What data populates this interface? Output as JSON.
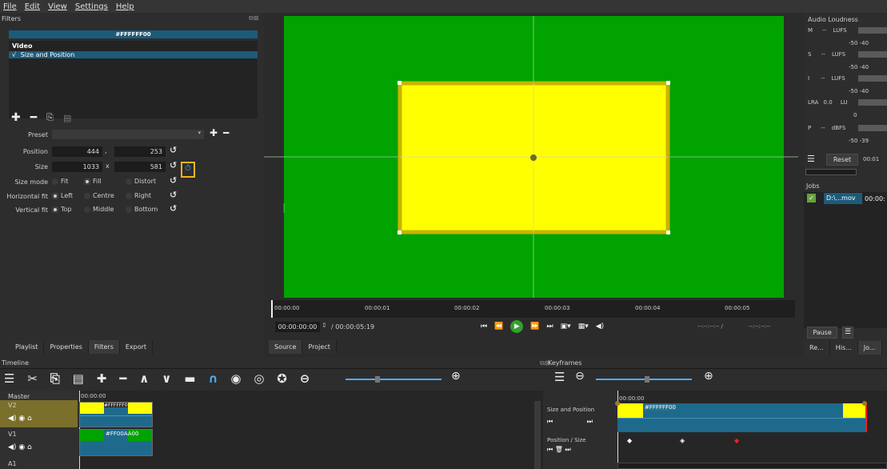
{
  "menu": [
    "File",
    "Edit",
    "View",
    "Settings",
    "Help"
  ],
  "filters": {
    "title": "Filters",
    "clip_name": "#FFFFFF00",
    "section": "Video",
    "check": "√",
    "item": "Size and Position",
    "preset_label": "Preset",
    "position_label": "Position",
    "position_x": "444",
    "position_sep": ",",
    "position_y": "253",
    "size_label": "Size",
    "size_w": "1033",
    "size_sep": "x",
    "size_h": "581",
    "size_mode_label": "Size mode",
    "size_mode_options": [
      "Fit",
      "Fill",
      "Distort"
    ],
    "hfit_label": "Horizontal fit",
    "hfit_options": [
      "Left",
      "Centre",
      "Right"
    ],
    "vfit_label": "Vertical fit",
    "vfit_options": [
      "Top",
      "Middle",
      "Bottom"
    ]
  },
  "left_tabs": [
    "Playlist",
    "Properties",
    "Filters",
    "Export"
  ],
  "viewer": {
    "ruler_ticks": [
      "00:00:00",
      "00:00:01",
      "00:00:02",
      "00:00:03",
      "00:00:04",
      "00:00:05"
    ],
    "current_time": "00:00:00:00",
    "total_time": "/ 00:00:05:19",
    "in_point": "--:--:--:-- /",
    "out_point": "--:--:--:--",
    "tabs": [
      "Source",
      "Project"
    ],
    "colors": {
      "bg": "#00a300",
      "rect": "#ffff00",
      "rect_border": "#c8b400"
    }
  },
  "audio": {
    "title": "Audio Loudness",
    "rows": [
      {
        "label": "M",
        "value": "--",
        "unit": "LUFS",
        "scale": "-50  -40"
      },
      {
        "label": "S",
        "value": "--",
        "unit": "LUFS",
        "scale": "-50  -40"
      },
      {
        "label": "I",
        "value": "--",
        "unit": "LUFS",
        "scale": "-50  -40"
      },
      {
        "label": "LRA",
        "value": "0.0",
        "unit": "LU",
        "scale": "0"
      },
      {
        "label": "P",
        "value": "--",
        "unit": "dBFS",
        "scale": "-50  -39"
      }
    ],
    "reset": "Reset",
    "reset_time": "00:01"
  },
  "jobs": {
    "title": "Jobs",
    "job_name": "D:\\...mov",
    "job_time": "00:00:",
    "pause": "Pause",
    "tabs": [
      "Re...",
      "His...",
      "Jo..."
    ]
  },
  "timeline": {
    "title": "Timeline",
    "tracks": [
      {
        "name": "Master"
      },
      {
        "name": "V2"
      },
      {
        "name": "V1"
      },
      {
        "name": "A1"
      }
    ],
    "time_start": "00:00:00",
    "v2_clip": "#FFFFFF00",
    "v1_clip": "#FF00AA00"
  },
  "keyframes": {
    "title": "Keyframes",
    "time_start": "00:00:00",
    "row1_label": "Size and Position",
    "clip_name": "#FFFFFF00",
    "row2_label": "Position / Size"
  }
}
